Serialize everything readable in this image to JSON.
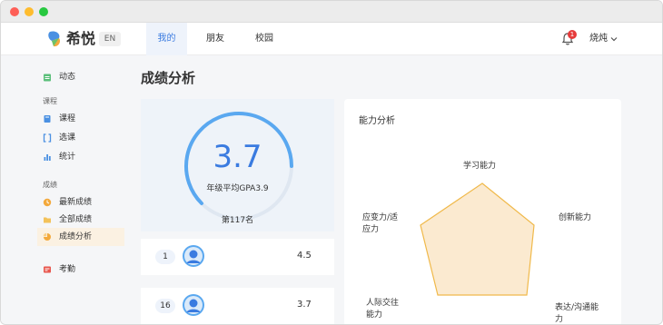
{
  "app": {
    "brand": "希悦",
    "lang_button": "EN"
  },
  "nav": {
    "tabs": [
      {
        "label": "我的",
        "active": true
      },
      {
        "label": "朋友",
        "active": false
      },
      {
        "label": "校园",
        "active": false
      }
    ],
    "notification_count": "1",
    "user_name": "烧炖"
  },
  "sidebar": {
    "top_item": {
      "label": "动态",
      "icon": "calendar-icon"
    },
    "groups": [
      {
        "title": "课程",
        "items": [
          {
            "label": "课程",
            "icon": "book-icon"
          },
          {
            "label": "选课",
            "icon": "bracket-icon"
          },
          {
            "label": "统计",
            "icon": "bar-chart-icon"
          }
        ]
      },
      {
        "title": "成绩",
        "items": [
          {
            "label": "最新成绩",
            "icon": "clock-icon"
          },
          {
            "label": "全部成绩",
            "icon": "folder-icon"
          },
          {
            "label": "成绩分析",
            "icon": "pie-icon",
            "active": true
          }
        ]
      }
    ],
    "bottom_item": {
      "label": "考勤",
      "icon": "attendance-icon"
    }
  },
  "main": {
    "title": "成绩分析",
    "gpa": {
      "value": "3.7",
      "label": "年级平均GPA3.9",
      "rank": "第117名"
    },
    "rows": [
      {
        "rank": "1",
        "score": "4.5"
      },
      {
        "rank": "16",
        "score": "3.7"
      }
    ],
    "ability": {
      "title": "能力分析",
      "axes": [
        "学习能力",
        "创新能力",
        "表达/沟通能力",
        "人际交往能力",
        "应变力/适应力"
      ]
    }
  },
  "colors": {
    "accent": "#3a7be0",
    "ring": "#5aa8f0",
    "radar_fill": "#fbead0",
    "radar_stroke": "#f0b94a",
    "active_sidebar": "#fbf1e2"
  }
}
